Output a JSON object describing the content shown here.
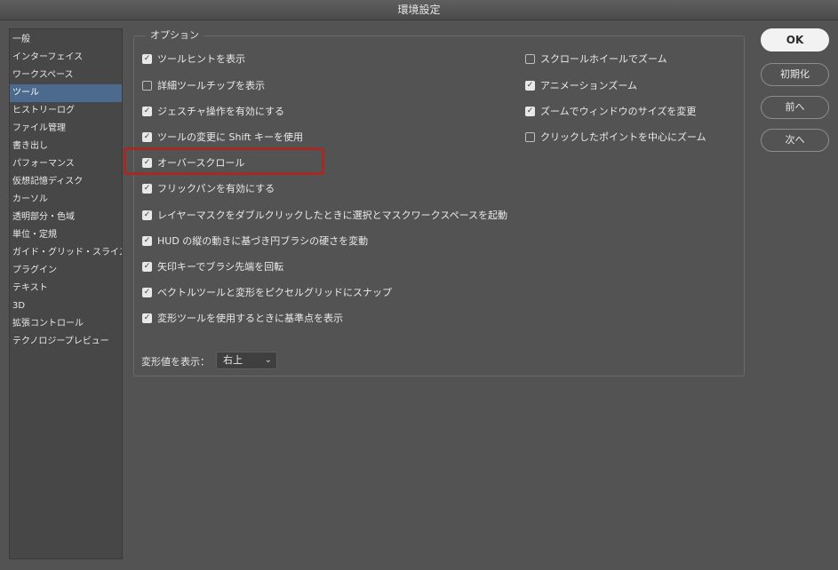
{
  "window": {
    "title": "環境設定"
  },
  "sidebar": {
    "items": [
      {
        "label": "一般"
      },
      {
        "label": "インターフェイス"
      },
      {
        "label": "ワークスペース"
      },
      {
        "label": "ツール",
        "selected": true
      },
      {
        "label": "ヒストリーログ"
      },
      {
        "label": "ファイル管理"
      },
      {
        "label": "書き出し"
      },
      {
        "label": "パフォーマンス"
      },
      {
        "label": "仮想記憶ディスク"
      },
      {
        "label": "カーソル"
      },
      {
        "label": "透明部分・色域"
      },
      {
        "label": "単位・定規"
      },
      {
        "label": "ガイド・グリッド・スライス"
      },
      {
        "label": "プラグイン"
      },
      {
        "label": "テキスト"
      },
      {
        "label": "3D"
      },
      {
        "label": "拡張コントロール"
      },
      {
        "label": "テクノロジープレビュー"
      }
    ]
  },
  "options": {
    "group_title": "オプション",
    "left": [
      {
        "label": "ツールヒントを表示",
        "checked": true
      },
      {
        "label": "詳細ツールチップを表示",
        "checked": false
      },
      {
        "label": "ジェスチャ操作を有効にする",
        "checked": true
      },
      {
        "label": "ツールの変更に Shift キーを使用",
        "checked": true
      },
      {
        "label": "オーバースクロール",
        "checked": true
      },
      {
        "label": "フリックパンを有効にする",
        "checked": true
      },
      {
        "label": "レイヤーマスクをダブルクリックしたときに選択とマスクワークスペースを起動",
        "checked": true
      },
      {
        "label": "HUD の縦の動きに基づき円ブラシの硬さを変動",
        "checked": true
      },
      {
        "label": "矢印キーでブラシ先端を回転",
        "checked": true
      },
      {
        "label": "ベクトルツールと変形をピクセルグリッドにスナップ",
        "checked": true
      },
      {
        "label": "変形ツールを使用するときに基準点を表示",
        "checked": true
      }
    ],
    "right": [
      {
        "label": "スクロールホイールでズーム",
        "checked": false
      },
      {
        "label": "アニメーションズーム",
        "checked": true
      },
      {
        "label": "ズームでウィンドウのサイズを変更",
        "checked": true
      },
      {
        "label": "クリックしたポイントを中心にズーム",
        "checked": false
      }
    ],
    "transform_label": "変形値を表示：",
    "transform_value": "右上"
  },
  "buttons": {
    "ok": "OK",
    "reset": "初期化",
    "prev": "前へ",
    "next": "次へ"
  },
  "colors": {
    "background": "#535353",
    "selection": "#4b6a8d",
    "highlight_border": "#a32b24"
  }
}
